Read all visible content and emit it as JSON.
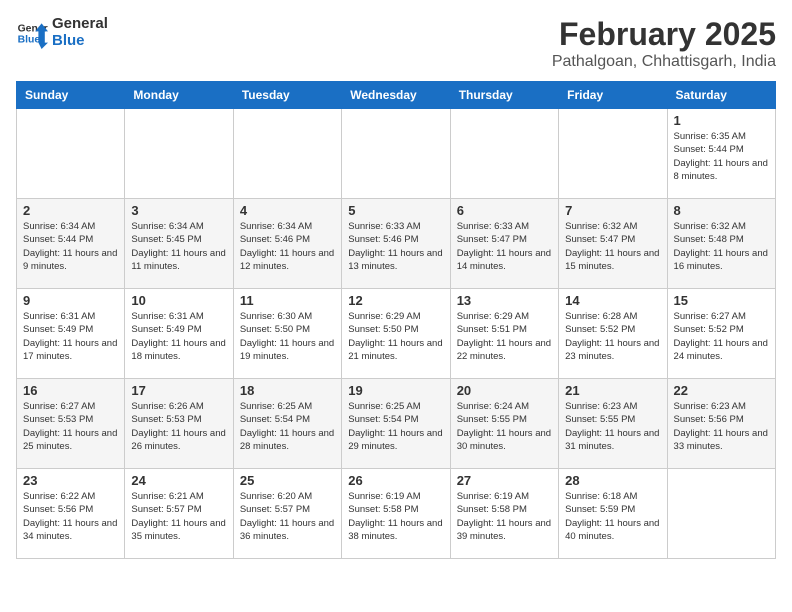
{
  "logo": {
    "line1": "General",
    "line2": "Blue"
  },
  "title": "February 2025",
  "location": "Pathalgoan, Chhattisgarh, India",
  "weekdays": [
    "Sunday",
    "Monday",
    "Tuesday",
    "Wednesday",
    "Thursday",
    "Friday",
    "Saturday"
  ],
  "weeks": [
    [
      {
        "day": "",
        "info": ""
      },
      {
        "day": "",
        "info": ""
      },
      {
        "day": "",
        "info": ""
      },
      {
        "day": "",
        "info": ""
      },
      {
        "day": "",
        "info": ""
      },
      {
        "day": "",
        "info": ""
      },
      {
        "day": "1",
        "info": "Sunrise: 6:35 AM\nSunset: 5:44 PM\nDaylight: 11 hours and 8 minutes."
      }
    ],
    [
      {
        "day": "2",
        "info": "Sunrise: 6:34 AM\nSunset: 5:44 PM\nDaylight: 11 hours and 9 minutes."
      },
      {
        "day": "3",
        "info": "Sunrise: 6:34 AM\nSunset: 5:45 PM\nDaylight: 11 hours and 11 minutes."
      },
      {
        "day": "4",
        "info": "Sunrise: 6:34 AM\nSunset: 5:46 PM\nDaylight: 11 hours and 12 minutes."
      },
      {
        "day": "5",
        "info": "Sunrise: 6:33 AM\nSunset: 5:46 PM\nDaylight: 11 hours and 13 minutes."
      },
      {
        "day": "6",
        "info": "Sunrise: 6:33 AM\nSunset: 5:47 PM\nDaylight: 11 hours and 14 minutes."
      },
      {
        "day": "7",
        "info": "Sunrise: 6:32 AM\nSunset: 5:47 PM\nDaylight: 11 hours and 15 minutes."
      },
      {
        "day": "8",
        "info": "Sunrise: 6:32 AM\nSunset: 5:48 PM\nDaylight: 11 hours and 16 minutes."
      }
    ],
    [
      {
        "day": "9",
        "info": "Sunrise: 6:31 AM\nSunset: 5:49 PM\nDaylight: 11 hours and 17 minutes."
      },
      {
        "day": "10",
        "info": "Sunrise: 6:31 AM\nSunset: 5:49 PM\nDaylight: 11 hours and 18 minutes."
      },
      {
        "day": "11",
        "info": "Sunrise: 6:30 AM\nSunset: 5:50 PM\nDaylight: 11 hours and 19 minutes."
      },
      {
        "day": "12",
        "info": "Sunrise: 6:29 AM\nSunset: 5:50 PM\nDaylight: 11 hours and 21 minutes."
      },
      {
        "day": "13",
        "info": "Sunrise: 6:29 AM\nSunset: 5:51 PM\nDaylight: 11 hours and 22 minutes."
      },
      {
        "day": "14",
        "info": "Sunrise: 6:28 AM\nSunset: 5:52 PM\nDaylight: 11 hours and 23 minutes."
      },
      {
        "day": "15",
        "info": "Sunrise: 6:27 AM\nSunset: 5:52 PM\nDaylight: 11 hours and 24 minutes."
      }
    ],
    [
      {
        "day": "16",
        "info": "Sunrise: 6:27 AM\nSunset: 5:53 PM\nDaylight: 11 hours and 25 minutes."
      },
      {
        "day": "17",
        "info": "Sunrise: 6:26 AM\nSunset: 5:53 PM\nDaylight: 11 hours and 26 minutes."
      },
      {
        "day": "18",
        "info": "Sunrise: 6:25 AM\nSunset: 5:54 PM\nDaylight: 11 hours and 28 minutes."
      },
      {
        "day": "19",
        "info": "Sunrise: 6:25 AM\nSunset: 5:54 PM\nDaylight: 11 hours and 29 minutes."
      },
      {
        "day": "20",
        "info": "Sunrise: 6:24 AM\nSunset: 5:55 PM\nDaylight: 11 hours and 30 minutes."
      },
      {
        "day": "21",
        "info": "Sunrise: 6:23 AM\nSunset: 5:55 PM\nDaylight: 11 hours and 31 minutes."
      },
      {
        "day": "22",
        "info": "Sunrise: 6:23 AM\nSunset: 5:56 PM\nDaylight: 11 hours and 33 minutes."
      }
    ],
    [
      {
        "day": "23",
        "info": "Sunrise: 6:22 AM\nSunset: 5:56 PM\nDaylight: 11 hours and 34 minutes."
      },
      {
        "day": "24",
        "info": "Sunrise: 6:21 AM\nSunset: 5:57 PM\nDaylight: 11 hours and 35 minutes."
      },
      {
        "day": "25",
        "info": "Sunrise: 6:20 AM\nSunset: 5:57 PM\nDaylight: 11 hours and 36 minutes."
      },
      {
        "day": "26",
        "info": "Sunrise: 6:19 AM\nSunset: 5:58 PM\nDaylight: 11 hours and 38 minutes."
      },
      {
        "day": "27",
        "info": "Sunrise: 6:19 AM\nSunset: 5:58 PM\nDaylight: 11 hours and 39 minutes."
      },
      {
        "day": "28",
        "info": "Sunrise: 6:18 AM\nSunset: 5:59 PM\nDaylight: 11 hours and 40 minutes."
      },
      {
        "day": "",
        "info": ""
      }
    ]
  ]
}
